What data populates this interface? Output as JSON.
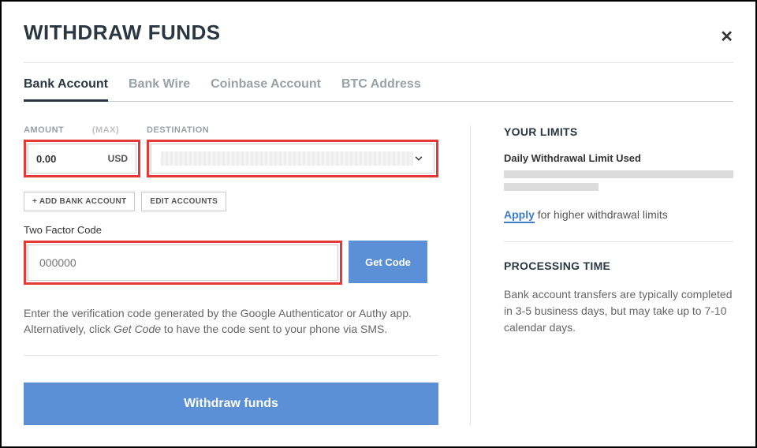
{
  "header": {
    "title": "WITHDRAW FUNDS"
  },
  "tabs": {
    "bank_account": "Bank Account",
    "bank_wire": "Bank Wire",
    "coinbase": "Coinbase Account",
    "btc": "BTC Address"
  },
  "form": {
    "amount_label": "AMOUNT",
    "max_label": "(MAX)",
    "destination_label": "DESTINATION",
    "amount_value": "0.00",
    "currency": "USD",
    "add_bank_label": "+ ADD BANK ACCOUNT",
    "edit_accounts_label": "EDIT ACCOUNTS",
    "two_factor_label": "Two Factor Code",
    "two_factor_placeholder": "000000",
    "get_code_label": "Get Code",
    "help_text_1": "Enter the verification code generated by the Google Authenticator or Authy app. Alternatively, click ",
    "help_text_em": "Get Code",
    "help_text_2": " to have the code sent to your phone via SMS.",
    "withdraw_label": "Withdraw funds"
  },
  "limits": {
    "heading": "YOUR LIMITS",
    "daily_label": "Daily Withdrawal Limit Used",
    "apply_link": "Apply",
    "apply_rest": " for higher withdrawal limits"
  },
  "processing": {
    "heading": "PROCESSING TIME",
    "text": "Bank account transfers are typically completed in 3-5 business days, but may take up to 7-10 calendar days."
  }
}
